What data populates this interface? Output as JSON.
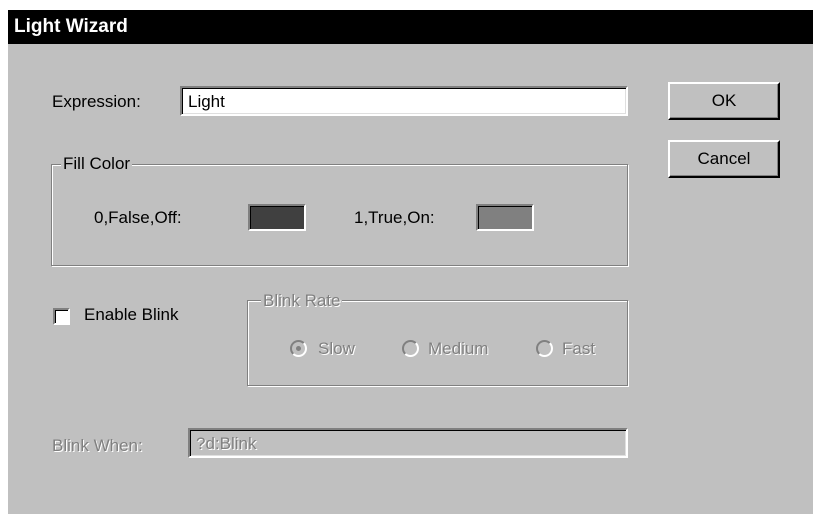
{
  "window": {
    "title": "Light Wizard"
  },
  "expression": {
    "label": "Expression:",
    "value": "Light"
  },
  "buttons": {
    "ok": "OK",
    "cancel": "Cancel"
  },
  "fill_color": {
    "title": "Fill Color",
    "off_label": "0,False,Off:",
    "on_label": "1,True,On:",
    "off_color": "#404040",
    "on_color": "#808080"
  },
  "enable_blink": {
    "label": "Enable Blink",
    "checked": false
  },
  "blink_rate": {
    "title": "Blink Rate",
    "options": [
      "Slow",
      "Medium",
      "Fast"
    ],
    "selected": "Slow",
    "enabled": false
  },
  "blink_when": {
    "label": "Blink When:",
    "value": "?d:Blink",
    "enabled": false
  },
  "colors": {
    "dialog_bg": "#c0c0c0",
    "titlebar_bg": "#000000",
    "titlebar_text": "#ffffff",
    "disabled_text": "#808080"
  }
}
